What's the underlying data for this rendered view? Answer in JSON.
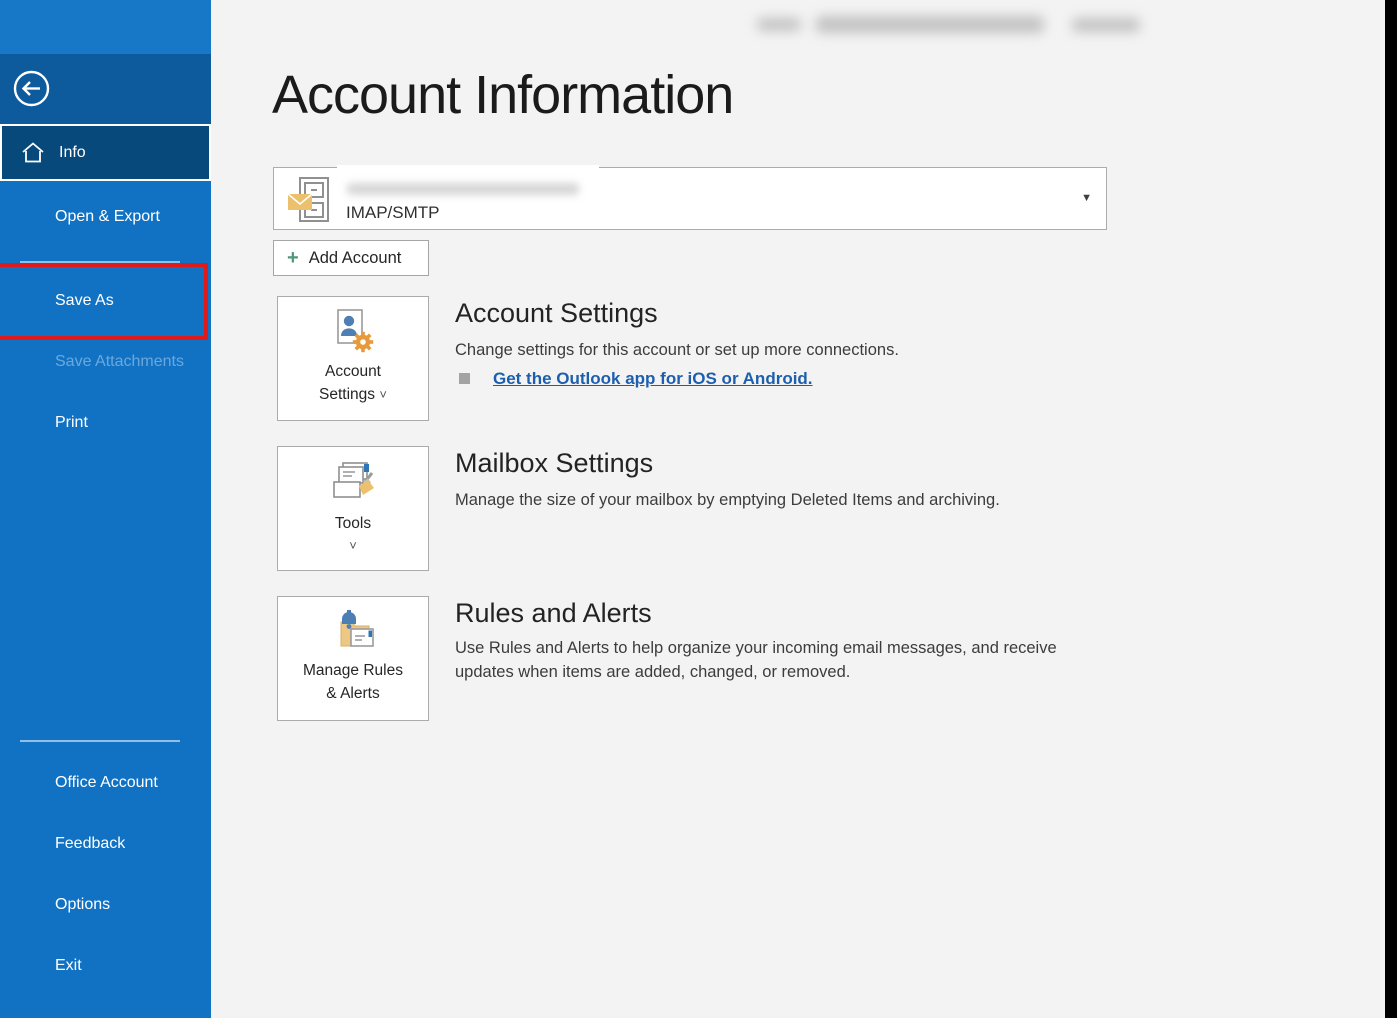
{
  "titlebar": {
    "redacted": true
  },
  "sidebar": {
    "items": [
      {
        "label": "Info",
        "selected": true,
        "disabled": false
      },
      {
        "label": "Open & Export",
        "selected": false,
        "disabled": false
      },
      {
        "label": "Save As",
        "selected": false,
        "disabled": false,
        "annotated": true
      },
      {
        "label": "Save Attachments",
        "selected": false,
        "disabled": true
      },
      {
        "label": "Print",
        "selected": false,
        "disabled": false
      }
    ],
    "footer_items": [
      {
        "label": "Office Account"
      },
      {
        "label": "Feedback"
      },
      {
        "label": "Options"
      },
      {
        "label": "Exit"
      }
    ]
  },
  "main": {
    "title": "Account Information",
    "account_selector": {
      "email_redacted": true,
      "protocol": "IMAP/SMTP"
    },
    "add_account_label": "Add Account",
    "sections": [
      {
        "button_label": "Account Settings",
        "heading": "Account Settings",
        "description": "Change settings for this account or set up more connections.",
        "link_text": "Get the Outlook app for iOS or Android."
      },
      {
        "button_label": "Tools",
        "heading": "Mailbox Settings",
        "description": "Manage the size of your mailbox by emptying Deleted Items and archiving."
      },
      {
        "button_label": "Manage Rules & Alerts",
        "heading": "Rules and Alerts",
        "description": "Use Rules and Alerts to help organize your incoming email messages, and receive updates when items are added, changed, or removed."
      }
    ]
  },
  "icons": {
    "chevron_down": "˅",
    "dropdown_caret": "▼",
    "plus": "+"
  },
  "colors": {
    "sidebar_blue": "#1172C4",
    "sidebar_top_blue": "#1878C8",
    "back_band_blue": "#0D5B9D",
    "selected_navy": "#08497C",
    "annotation_red": "#E01A1A",
    "link_blue": "#1D5FAE",
    "plus_green": "#4E9678",
    "main_bg": "#F3F3F3"
  }
}
